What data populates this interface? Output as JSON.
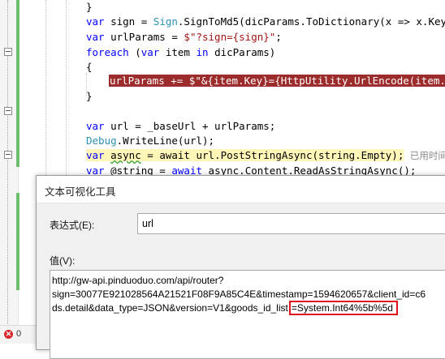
{
  "editor": {
    "lines": {
      "l1": "}",
      "l2_a": "var",
      "l2_b": " sign = ",
      "l2_c": "Sign",
      "l2_d": ".SignToMd5(dicParams.ToDictionary(x => x.Key,",
      "l3_a": "var",
      "l3_b": " urlParams = ",
      "l3_c": "$\"?sign={sign}\"",
      "l3_d": ";",
      "l4_a": "foreach",
      "l4_b": " (",
      "l4_c": "var",
      "l4_d": " item ",
      "l4_e": "in",
      "l4_f": " dicParams)",
      "l5": "{",
      "l6": "urlParams += $\"&{item.Key}={HttpUtility.UrlEncode(item.V",
      "l7": "}",
      "l8_a": "var",
      "l8_b": " url = _baseUrl + urlParams;",
      "l9_a": "Debug",
      "l9_b": ".WriteLine(url);",
      "l10_a": "var",
      "l10_b": "async",
      "l10_c": " = await url.PostStringAsync(string.Empty);",
      "l10_hint": "已用时间",
      "l11_a": "var",
      "l11_b": " @string = ",
      "l11_c": "await",
      "l11_d": " async.Content.ReadAsStringAsync();"
    },
    "error_count": "0"
  },
  "dialog": {
    "title": "文本可视化工具",
    "expression_label": "表达式(E):",
    "expression_value": "url",
    "value_label": "值(V):",
    "value_line1": "http://gw-api.pinduoduo.com/api/router?",
    "value_line2": "sign=30077E921028564A21521F08F9A85C4E&timestamp=1594620657&client_id=c6",
    "value_line3_a": "ds.detail&data_type=JSON&version=V1&goods_id_list",
    "value_line3_b": "=System.Int64%5b%5d"
  },
  "colors": {
    "keyword": "#0000ff",
    "type": "#2b91af",
    "string": "#a31515",
    "breakpoint_highlight": "#9c2b2b",
    "current_line_highlight": "#fff6b8",
    "annotation_box": "#e0141e"
  }
}
